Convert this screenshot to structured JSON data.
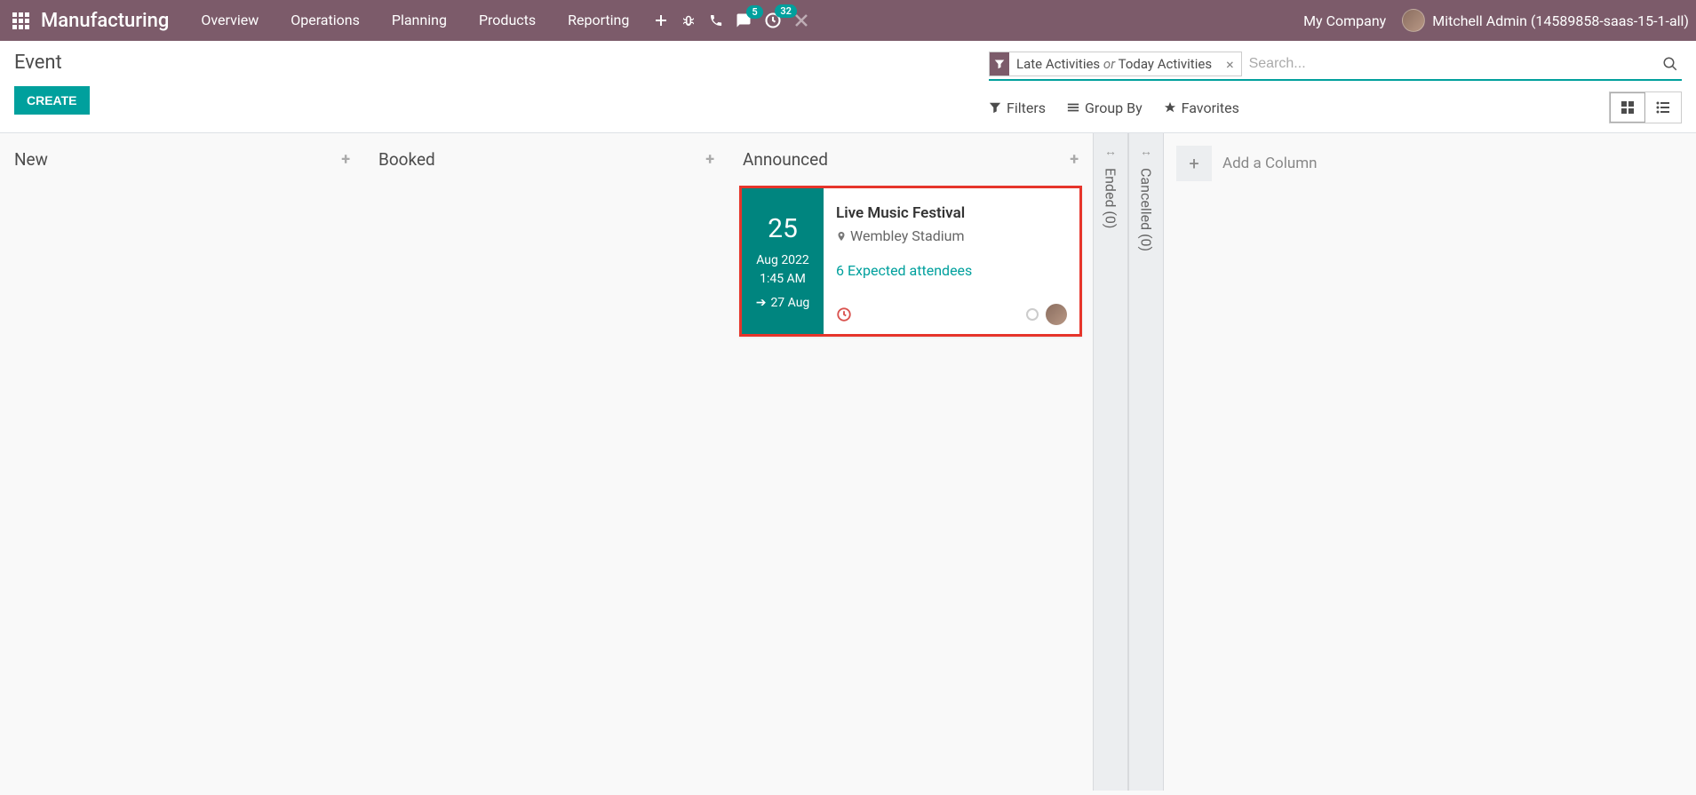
{
  "navbar": {
    "brand": "Manufacturing",
    "menu": [
      "Overview",
      "Operations",
      "Planning",
      "Products",
      "Reporting"
    ],
    "msg_badge": "5",
    "activity_badge": "32",
    "company": "My Company",
    "user": "Mitchell Admin (14589858-saas-15-1-all)"
  },
  "breadcrumb": "Event",
  "create_btn": "CREATE",
  "search": {
    "facet_left": "Late Activities",
    "facet_or": "or",
    "facet_right": "Today Activities",
    "placeholder": "Search..."
  },
  "toolbar": {
    "filters": "Filters",
    "groupby": "Group By",
    "favorites": "Favorites"
  },
  "columns": {
    "new": "New",
    "booked": "Booked",
    "announced": "Announced"
  },
  "card": {
    "day": "25",
    "monthyear": "Aug 2022",
    "time": "1:45 AM",
    "end": "27 Aug",
    "title": "Live Music Festival",
    "location": "Wembley Stadium",
    "attendees": "6 Expected attendees"
  },
  "folded": {
    "ended": "Ended (0)",
    "cancelled": "Cancelled (0)"
  },
  "add_column": "Add a Column"
}
